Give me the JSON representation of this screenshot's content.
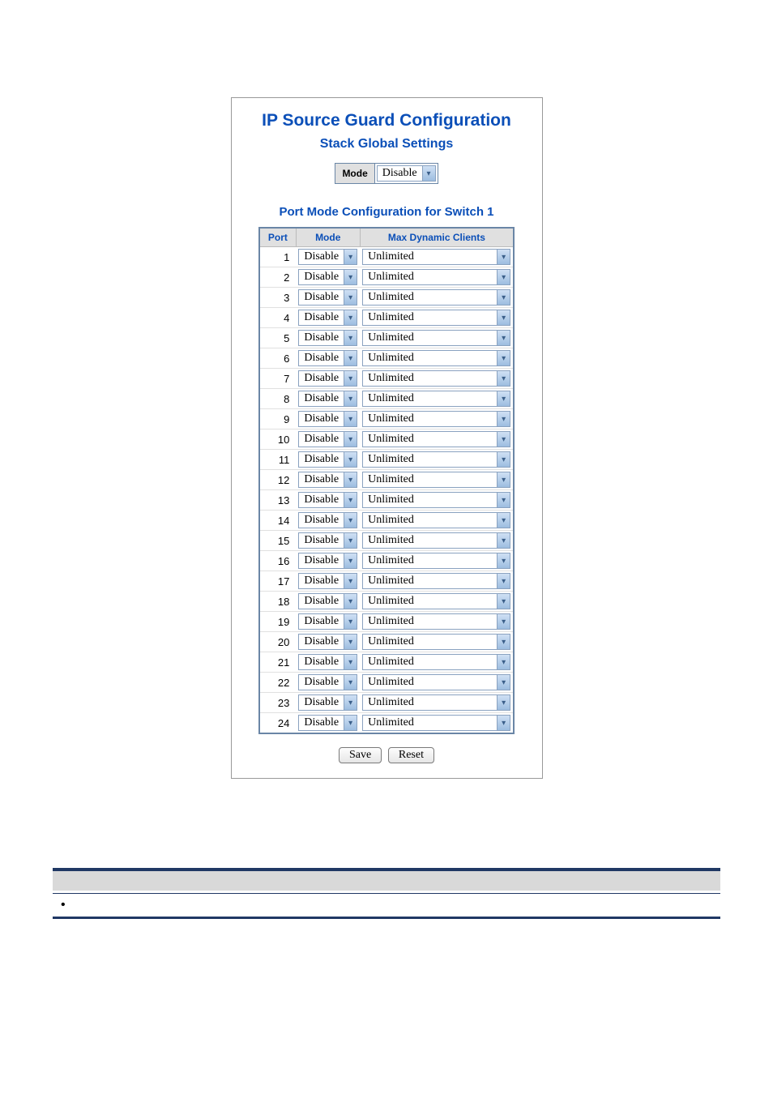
{
  "title": "IP Source Guard Configuration",
  "stack": {
    "subtitle": "Stack Global Settings",
    "mode_label": "Mode",
    "mode_value": "Disable"
  },
  "portSection": {
    "title": "Port Mode Configuration for Switch 1",
    "headers": {
      "port": "Port",
      "mode": "Mode",
      "max": "Max Dynamic Clients"
    },
    "rows": [
      {
        "port": "1",
        "mode": "Disable",
        "max": "Unlimited"
      },
      {
        "port": "2",
        "mode": "Disable",
        "max": "Unlimited"
      },
      {
        "port": "3",
        "mode": "Disable",
        "max": "Unlimited"
      },
      {
        "port": "4",
        "mode": "Disable",
        "max": "Unlimited"
      },
      {
        "port": "5",
        "mode": "Disable",
        "max": "Unlimited"
      },
      {
        "port": "6",
        "mode": "Disable",
        "max": "Unlimited"
      },
      {
        "port": "7",
        "mode": "Disable",
        "max": "Unlimited"
      },
      {
        "port": "8",
        "mode": "Disable",
        "max": "Unlimited"
      },
      {
        "port": "9",
        "mode": "Disable",
        "max": "Unlimited"
      },
      {
        "port": "10",
        "mode": "Disable",
        "max": "Unlimited"
      },
      {
        "port": "11",
        "mode": "Disable",
        "max": "Unlimited"
      },
      {
        "port": "12",
        "mode": "Disable",
        "max": "Unlimited"
      },
      {
        "port": "13",
        "mode": "Disable",
        "max": "Unlimited"
      },
      {
        "port": "14",
        "mode": "Disable",
        "max": "Unlimited"
      },
      {
        "port": "15",
        "mode": "Disable",
        "max": "Unlimited"
      },
      {
        "port": "16",
        "mode": "Disable",
        "max": "Unlimited"
      },
      {
        "port": "17",
        "mode": "Disable",
        "max": "Unlimited"
      },
      {
        "port": "18",
        "mode": "Disable",
        "max": "Unlimited"
      },
      {
        "port": "19",
        "mode": "Disable",
        "max": "Unlimited"
      },
      {
        "port": "20",
        "mode": "Disable",
        "max": "Unlimited"
      },
      {
        "port": "21",
        "mode": "Disable",
        "max": "Unlimited"
      },
      {
        "port": "22",
        "mode": "Disable",
        "max": "Unlimited"
      },
      {
        "port": "23",
        "mode": "Disable",
        "max": "Unlimited"
      },
      {
        "port": "24",
        "mode": "Disable",
        "max": "Unlimited"
      }
    ]
  },
  "buttons": {
    "save": "Save",
    "reset": "Reset"
  }
}
